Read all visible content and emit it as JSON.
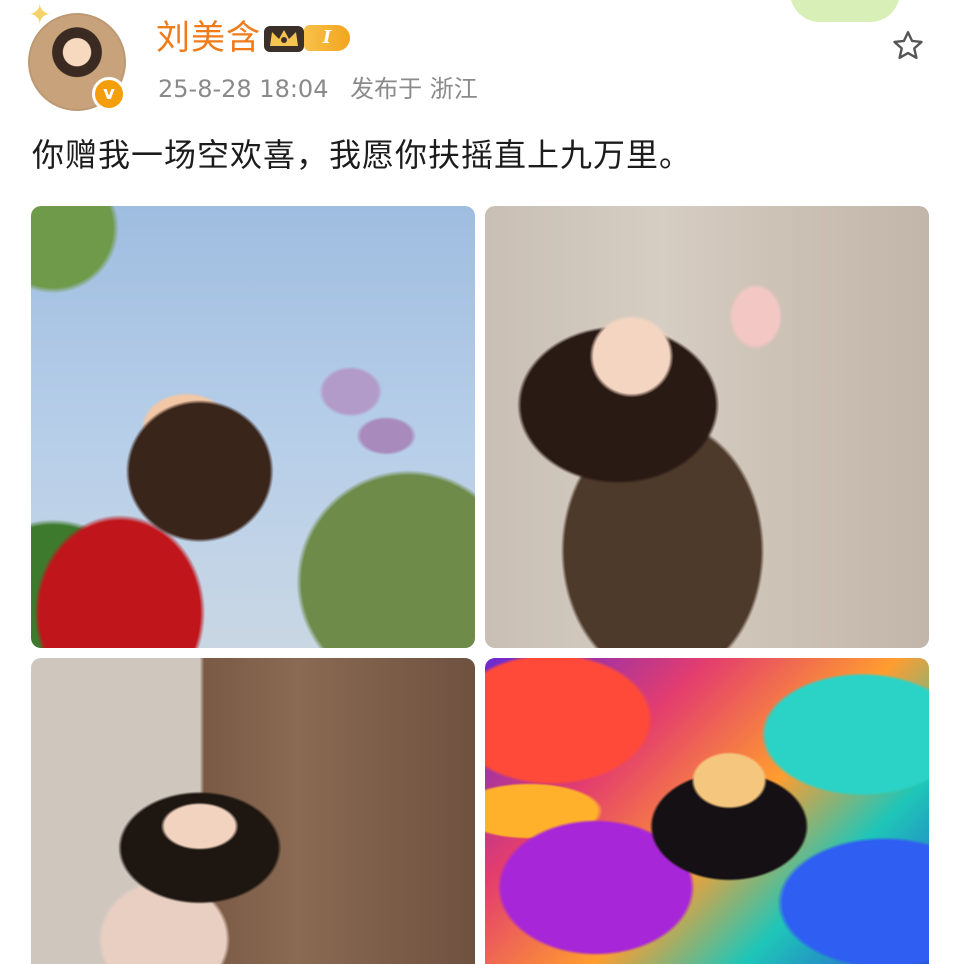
{
  "post": {
    "author": {
      "name": "刘美含",
      "badge_level": "I",
      "verified_mark": "v"
    },
    "meta": {
      "datetime": "25-8-28 18:04",
      "location": "发布于 浙江"
    },
    "text": "你赠我一场空欢喜，我愿你扶摇直上九万里。",
    "photos": [
      {
        "name": "photo-1"
      },
      {
        "name": "photo-2"
      },
      {
        "name": "photo-3"
      },
      {
        "name": "photo-4"
      }
    ],
    "icons": {
      "favorite": "star-icon",
      "vip_crown": "crown-icon",
      "verified": "verified-badge-icon"
    },
    "colors": {
      "username": "#f07b1a",
      "meta_text": "#8a8a8a",
      "badge": "#f2a51e",
      "verified": "#f59e0b"
    }
  }
}
